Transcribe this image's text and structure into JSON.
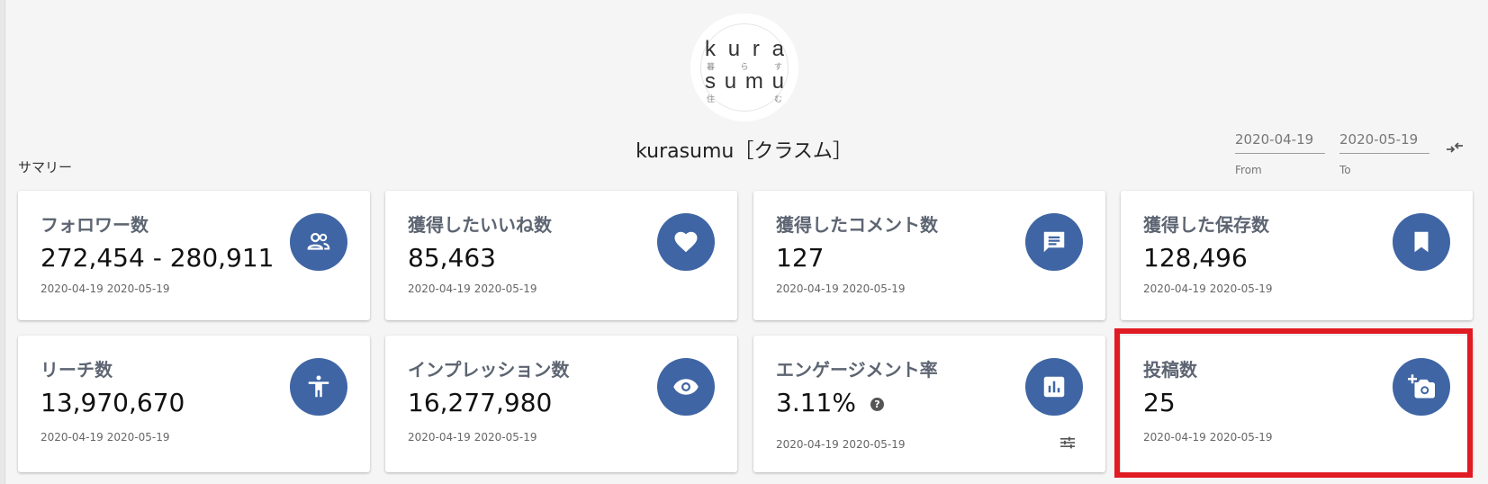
{
  "header": {
    "account_name": "kurasumu［クラスム］",
    "summary_label": "サマリー",
    "logo": {
      "row1": [
        "k",
        "u",
        "r",
        "a"
      ],
      "row2": [
        "暮",
        "ら",
        "す"
      ],
      "row3": [
        "s",
        "u",
        "m",
        "u"
      ],
      "row4": [
        "住",
        "む"
      ]
    }
  },
  "date_range": {
    "from_value": "2020-04-19",
    "from_caption": "From",
    "to_value": "2020-05-19",
    "to_caption": "To",
    "swap_icon": "swap-arrows-icon"
  },
  "cards": [
    {
      "title": "フォロワー数",
      "value": "272,454 - 280,911",
      "from": "2020-04-19",
      "to": "2020-05-19",
      "icon": "people-icon"
    },
    {
      "title": "獲得したいいね数",
      "value": "85,463",
      "from": "2020-04-19",
      "to": "2020-05-19",
      "icon": "heart-icon"
    },
    {
      "title": "獲得したコメント数",
      "value": "127",
      "from": "2020-04-19",
      "to": "2020-05-19",
      "icon": "comment-icon"
    },
    {
      "title": "獲得した保存数",
      "value": "128,496",
      "from": "2020-04-19",
      "to": "2020-05-19",
      "icon": "bookmark-icon"
    },
    {
      "title": "リーチ数",
      "value": "13,970,670",
      "from": "2020-04-19",
      "to": "2020-05-19",
      "icon": "accessibility-icon"
    },
    {
      "title": "インプレッション数",
      "value": "16,277,980",
      "from": "2020-04-19",
      "to": "2020-05-19",
      "icon": "eye-icon"
    },
    {
      "title": "エンゲージメント率",
      "value": "3.11%",
      "from": "2020-04-19",
      "to": "2020-05-19",
      "icon": "bar-chart-icon",
      "help": "?"
    },
    {
      "title": "投稿数",
      "value": "25",
      "from": "2020-04-19",
      "to": "2020-05-19",
      "icon": "add-photo-icon"
    }
  ],
  "colors": {
    "accent": "#3f65a4",
    "highlight": "#e01b24",
    "background": "#f5f5f5"
  }
}
